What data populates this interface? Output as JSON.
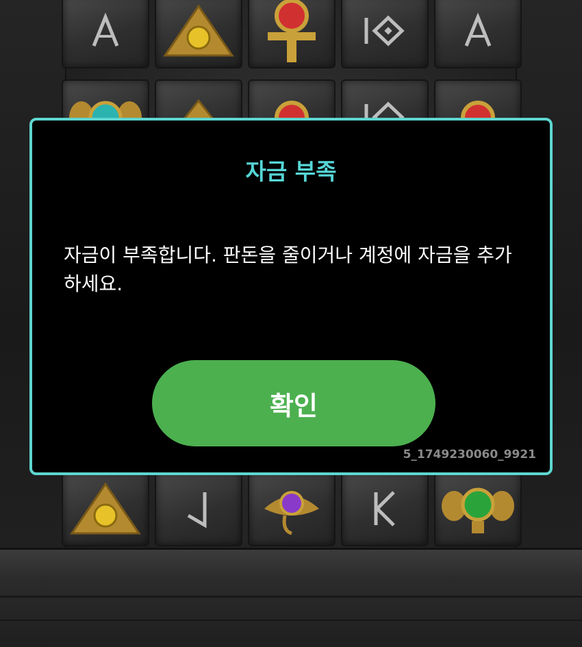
{
  "dialog": {
    "title": "자금 부족",
    "message": "자금이 부족합니다. 판돈을 줄이거나 계정에 자금을 추가하세요.",
    "confirm_label": "확인",
    "session_id": "5_1749230060_9921"
  },
  "colors": {
    "accent": "#5fd6d0",
    "title": "#56d6d6",
    "button": "#4cb04f",
    "gold": "#c9a13a"
  },
  "board_symbols": [
    "letter-a-rune",
    "eye-of-providence",
    "red-ankh",
    "diamond-rune",
    "letter-a-rune",
    "teal-scarab",
    "eye-of-providence",
    "red-ankh",
    "diamond-rune",
    "red-ankh",
    "eye-of-providence",
    "letter-l-rune",
    "purple-eye-of-horus",
    "letter-k-rune",
    "green-scarab"
  ]
}
